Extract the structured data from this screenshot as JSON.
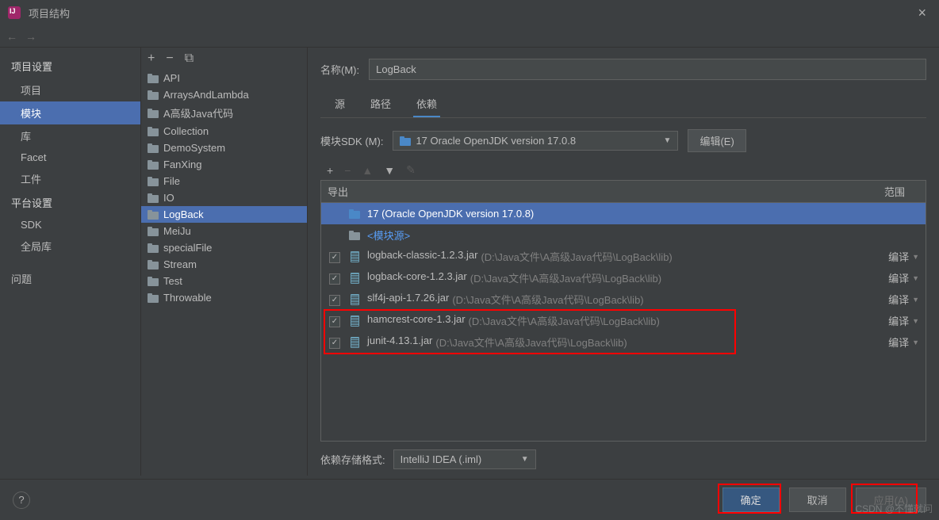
{
  "window": {
    "title": "项目结构"
  },
  "sidebar": {
    "section1": "项目设置",
    "items1": [
      "项目",
      "模块",
      "库",
      "Facet",
      "工件"
    ],
    "section2": "平台设置",
    "items2": [
      "SDK",
      "全局库"
    ],
    "issues": "问题"
  },
  "modules": {
    "items": [
      "API",
      "ArraysAndLambda",
      "A高级Java代码",
      "Collection",
      "DemoSystem",
      "FanXing",
      "File",
      "IO",
      "LogBack",
      "MeiJu",
      "specialFile",
      "Stream",
      "Test",
      "Throwable"
    ],
    "selected": "LogBack"
  },
  "content": {
    "name_label": "名称(M):",
    "name_value": "LogBack",
    "tabs": [
      "源",
      "路径",
      "依赖"
    ],
    "sdk_label": "模块SDK (M):",
    "sdk_value": "17 Oracle OpenJDK version 17.0.8",
    "edit_btn": "编辑(E)",
    "header_export": "导出",
    "header_scope": "范围",
    "deps": [
      {
        "name": "17 (Oracle OpenJDK version 17.0.8)",
        "type": "sdk"
      },
      {
        "name": "<模块源>",
        "type": "module"
      },
      {
        "name": "logback-classic-1.2.3.jar",
        "path": "(D:\\Java文件\\A高级Java代码\\LogBack\\lib)",
        "scope": "编译",
        "check": true
      },
      {
        "name": "logback-core-1.2.3.jar",
        "path": "(D:\\Java文件\\A高级Java代码\\LogBack\\lib)",
        "scope": "编译",
        "check": true
      },
      {
        "name": "slf4j-api-1.7.26.jar",
        "path": "(D:\\Java文件\\A高级Java代码\\LogBack\\lib)",
        "scope": "编译",
        "check": true
      },
      {
        "name": "hamcrest-core-1.3.jar",
        "path": "(D:\\Java文件\\A高级Java代码\\LogBack\\lib)",
        "scope": "编译",
        "check": true
      },
      {
        "name": "junit-4.13.1.jar",
        "path": "(D:\\Java文件\\A高级Java代码\\LogBack\\lib)",
        "scope": "编译",
        "check": true
      }
    ],
    "storage_label": "依赖存储格式:",
    "storage_value": "IntelliJ IDEA (.iml)"
  },
  "footer": {
    "ok": "确定",
    "cancel": "取消",
    "apply": "应用(A)"
  },
  "watermark": "CSDN @不懂就问"
}
